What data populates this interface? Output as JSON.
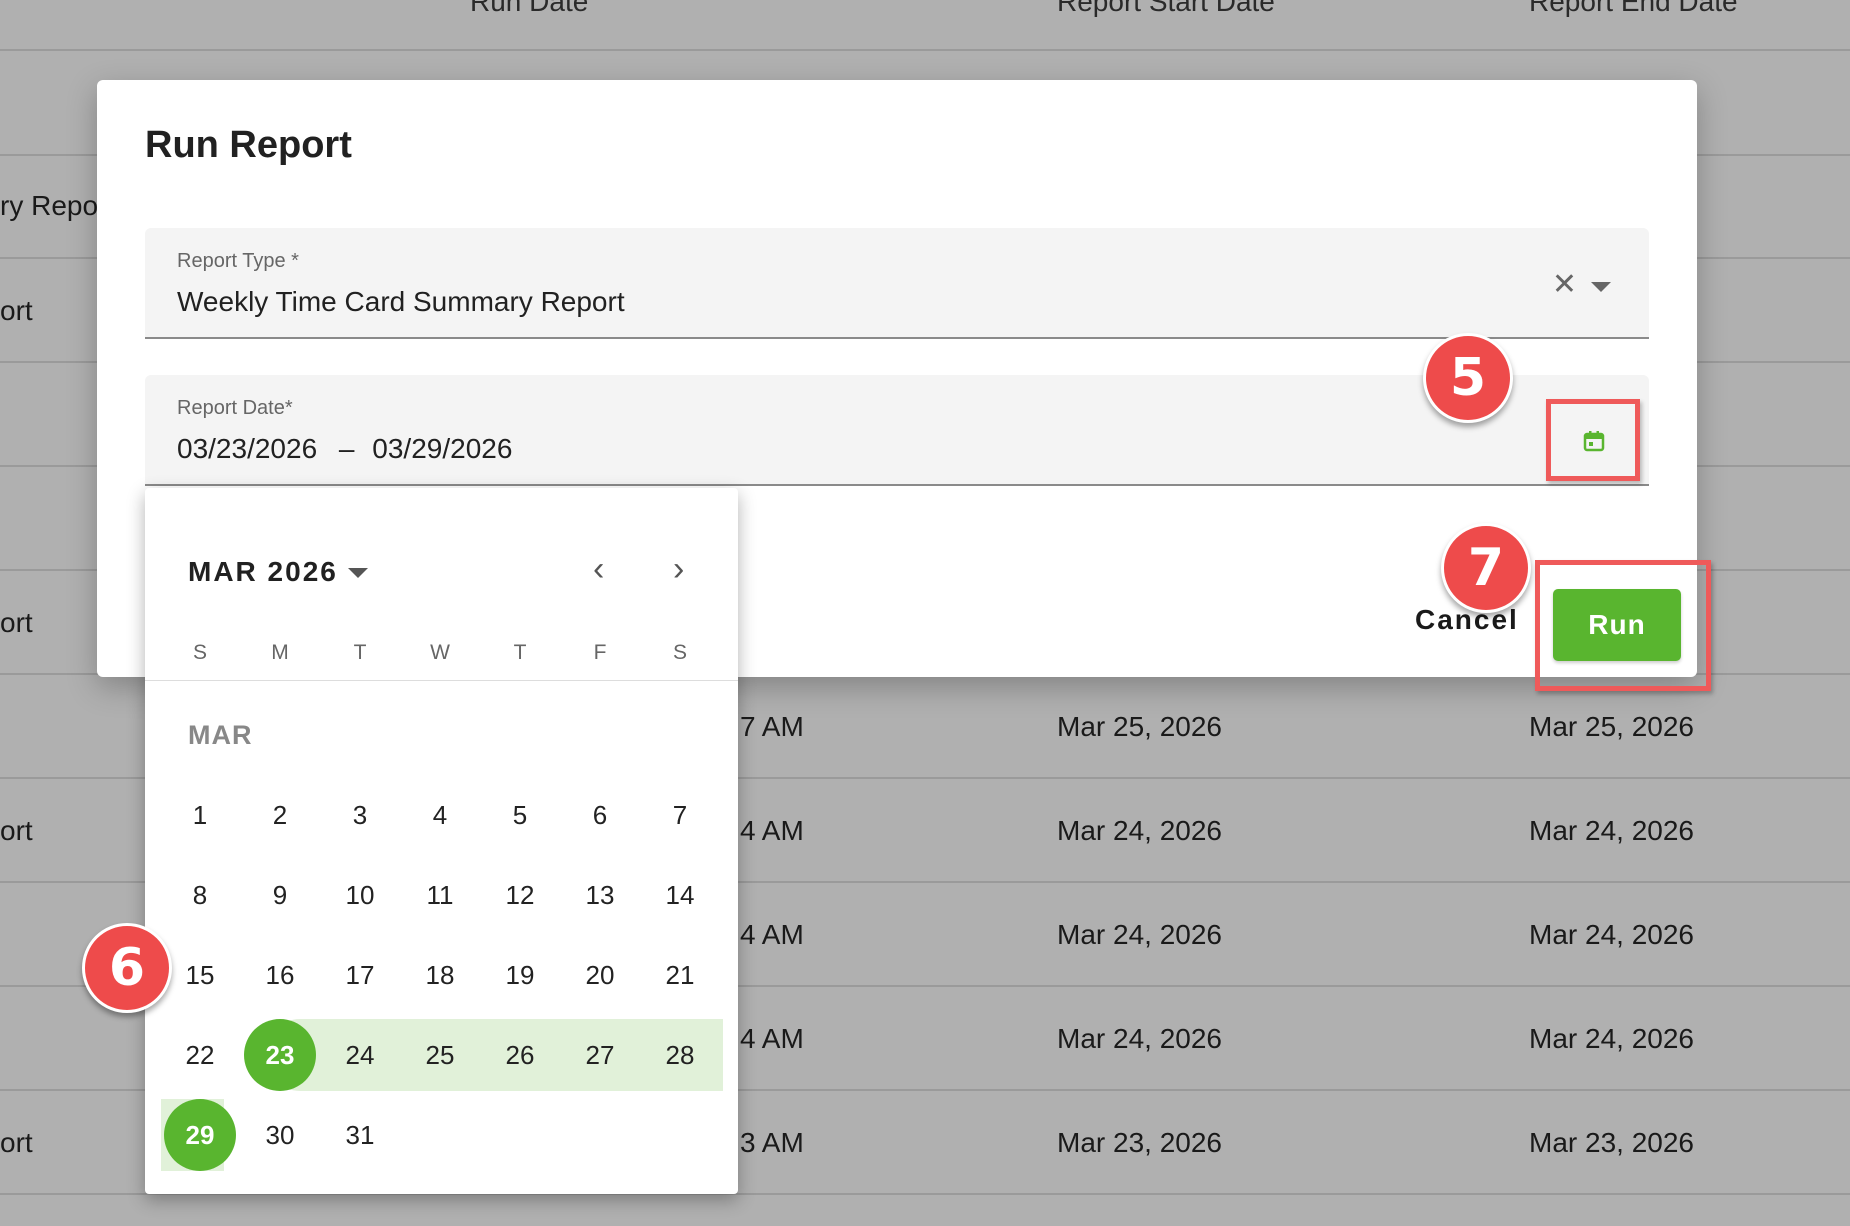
{
  "background": {
    "headers": [
      "Run Date",
      "Report Start Date",
      "Report End Date"
    ],
    "left_fragments": [
      "ry Repor",
      "ort",
      "ort",
      "ort",
      "ort"
    ],
    "run_time_fragments": [
      "7 AM",
      "4 AM",
      "4 AM",
      "4 AM",
      "3 AM"
    ],
    "start_dates": [
      "Mar 25, 2026",
      "Mar 24, 2026",
      "Mar 24, 2026",
      "Mar 24, 2026",
      "Mar 23, 2026"
    ],
    "end_dates": [
      "Mar 25, 2026",
      "Mar 24, 2026",
      "Mar 24, 2026",
      "Mar 24, 2026",
      "Mar 23, 2026"
    ]
  },
  "dialog": {
    "title": "Run Report",
    "report_type": {
      "label": "Report Type *",
      "value": "Weekly Time Card Summary Report",
      "clear_icon": "close-icon",
      "dropdown_icon": "caret-down-icon"
    },
    "report_date": {
      "label": "Report Date*",
      "start": "03/23/2026",
      "separator": "–",
      "end": "03/29/2026",
      "icon": "calendar-icon"
    },
    "cancel_label": "Cancel",
    "run_label": "Run"
  },
  "markers": {
    "five": "5",
    "six": "6",
    "seven": "7"
  },
  "calendar": {
    "month_select": "MAR 2026",
    "month_label": "MAR",
    "weekdays": [
      "S",
      "M",
      "T",
      "W",
      "T",
      "F",
      "S"
    ],
    "days": [
      "1",
      "2",
      "3",
      "4",
      "5",
      "6",
      "7",
      "8",
      "9",
      "10",
      "11",
      "12",
      "13",
      "14",
      "15",
      "16",
      "17",
      "18",
      "19",
      "20",
      "21",
      "22",
      "23",
      "24",
      "25",
      "26",
      "27",
      "28",
      "29",
      "30",
      "31"
    ],
    "range_start": "23",
    "range_end": "29"
  },
  "colors": {
    "accent": "#59b52f",
    "range": "#e1f1d9",
    "annotation": "#ee4b4b"
  }
}
